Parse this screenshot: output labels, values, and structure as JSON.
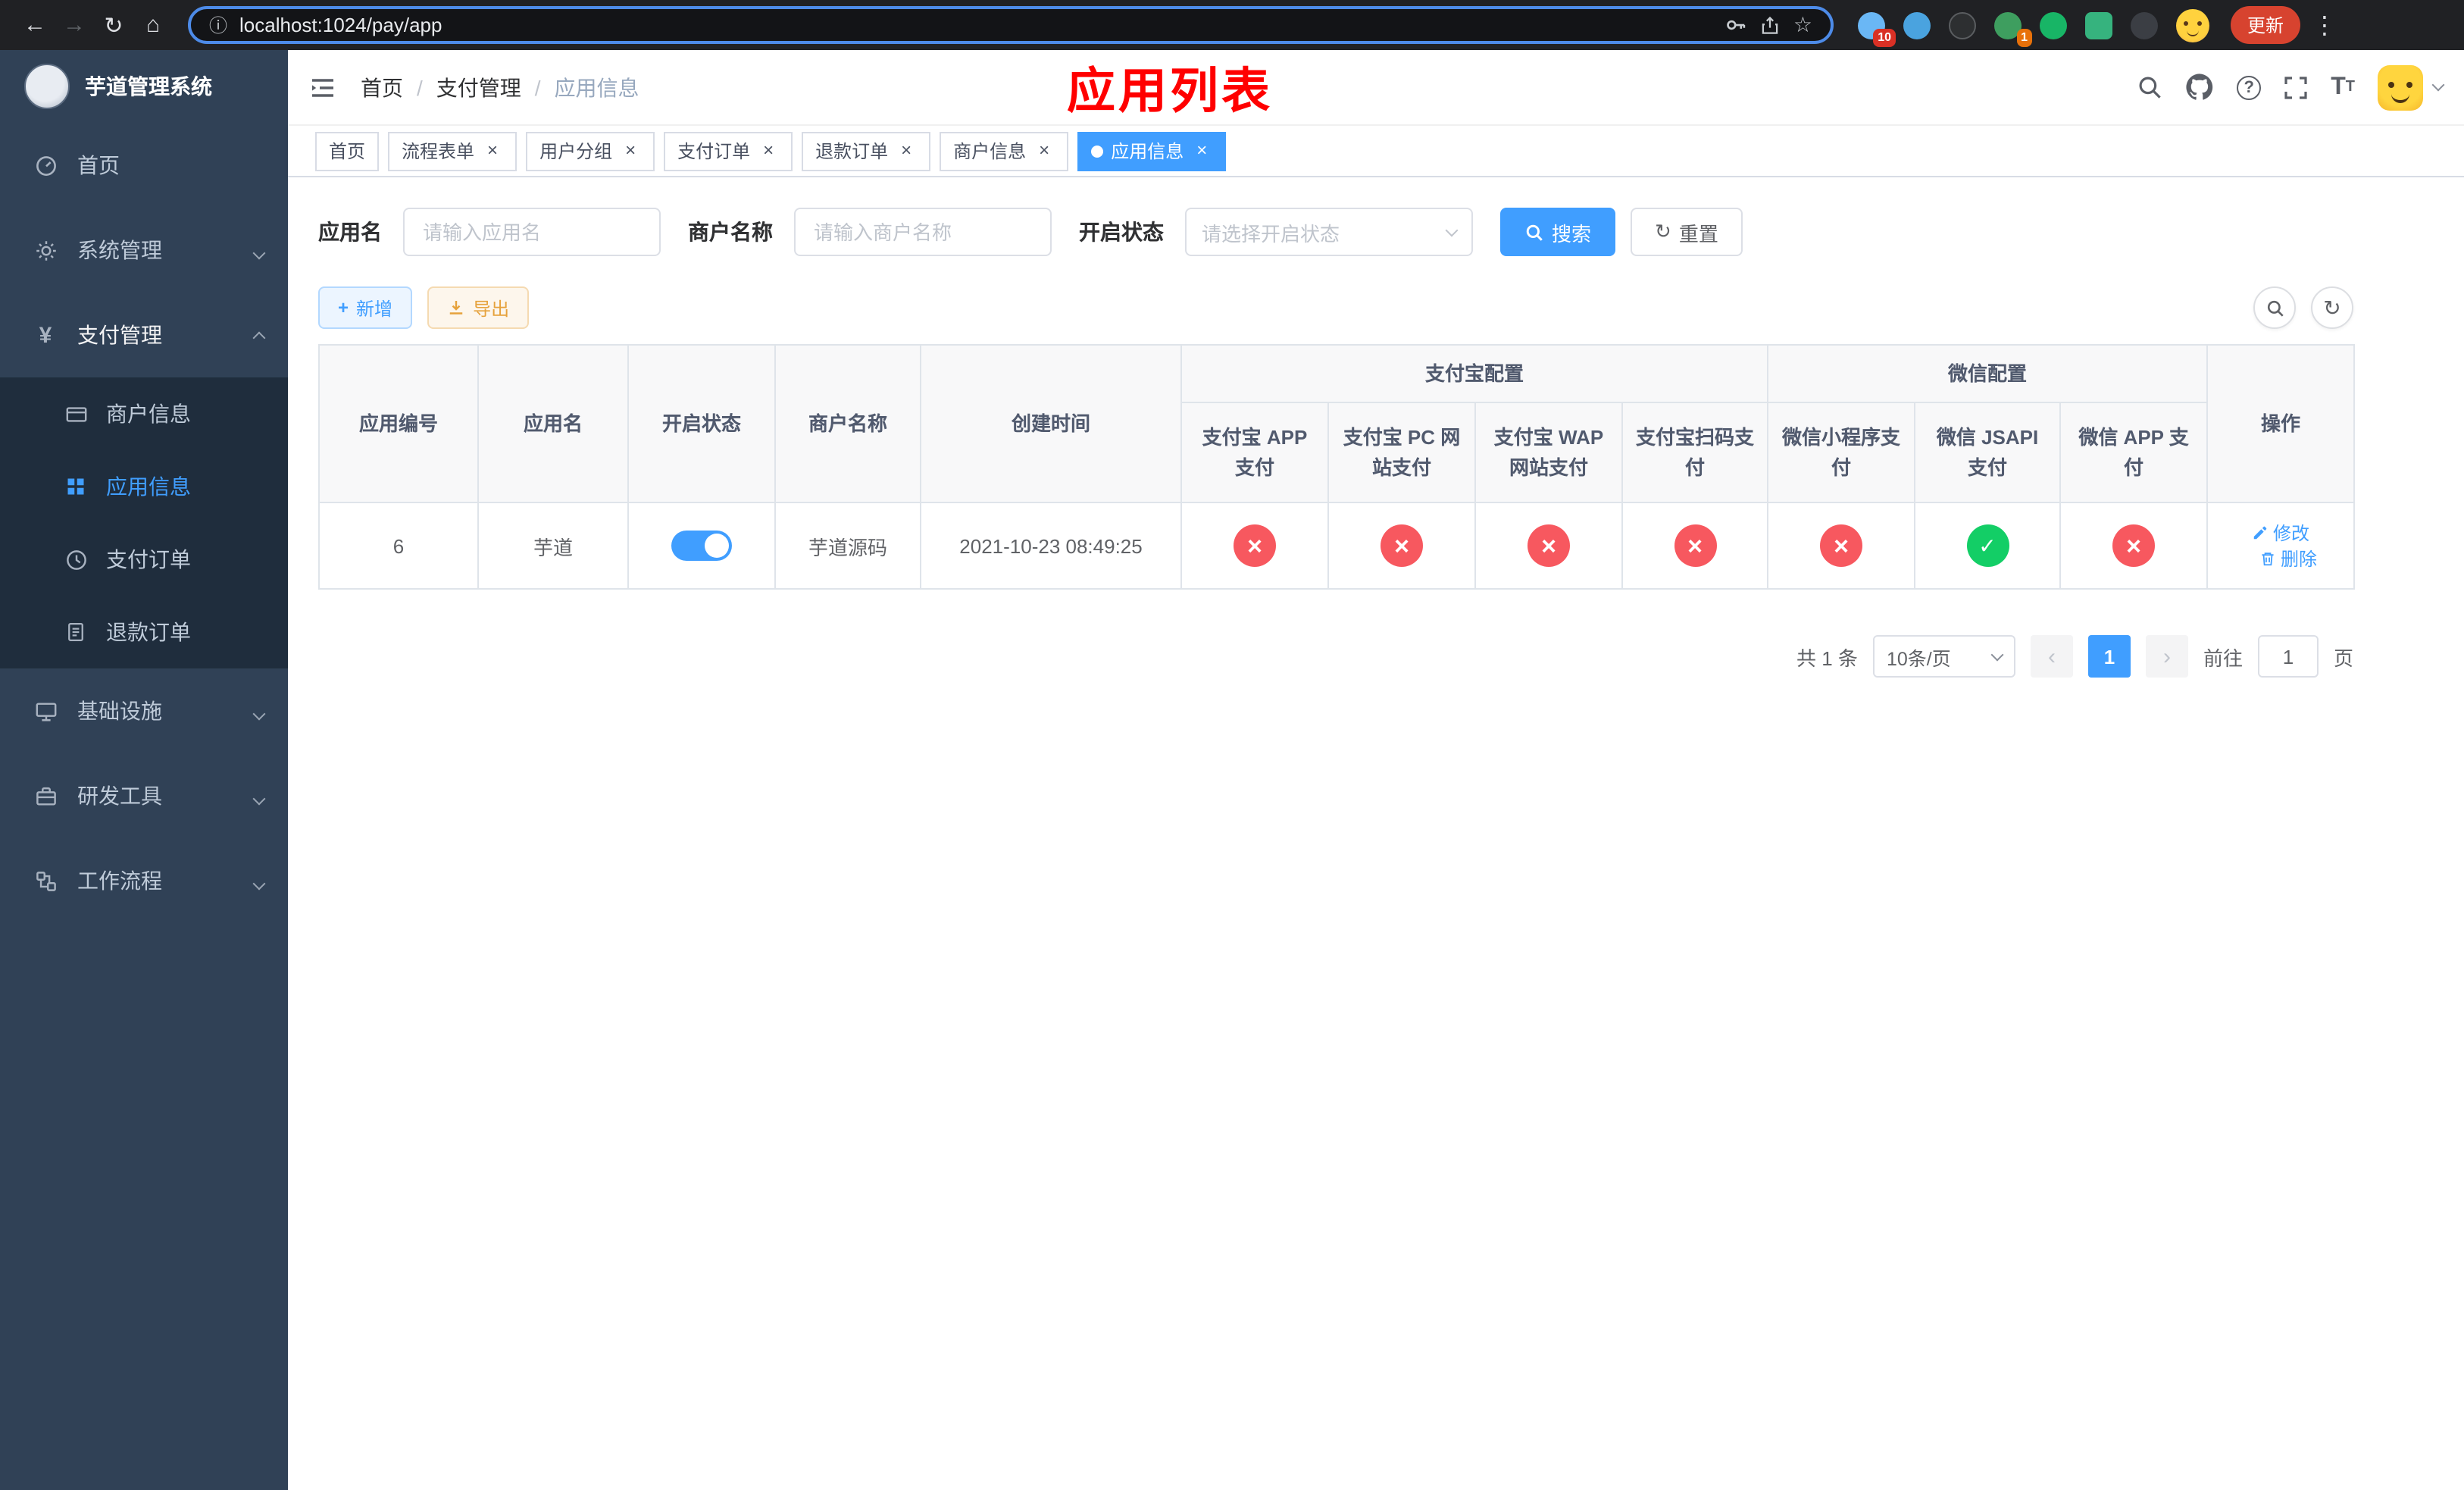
{
  "colors": {
    "accent": "#409eff",
    "danger": "#f7585f",
    "success": "#13ce66",
    "warning": "#e6a23c",
    "sidebar_bg": "#304156",
    "sidebar_submenu_bg": "#1f2d3d",
    "title_red": "#ff0000",
    "chrome_bg": "#202124"
  },
  "browser": {
    "url": "localhost:1024/pay/app",
    "update_button": "更新",
    "ext_badge_1": "10",
    "ext_badge_2": "1"
  },
  "sidebar": {
    "logo_title": "芋道管理系统",
    "items": [
      {
        "label": "首页"
      },
      {
        "label": "系统管理"
      },
      {
        "label": "支付管理"
      },
      {
        "label": "基础设施"
      },
      {
        "label": "研发工具"
      },
      {
        "label": "工作流程"
      }
    ],
    "payment_children": [
      {
        "label": "商户信息"
      },
      {
        "label": "应用信息"
      },
      {
        "label": "支付订单"
      },
      {
        "label": "退款订单"
      }
    ]
  },
  "header": {
    "breadcrumb": [
      "首页",
      "支付管理",
      "应用信息"
    ],
    "breadcrumb_separator": "/",
    "page_title": "应用列表"
  },
  "tabs": [
    {
      "label": "首页"
    },
    {
      "label": "流程表单"
    },
    {
      "label": "用户分组"
    },
    {
      "label": "支付订单"
    },
    {
      "label": "退款订单"
    },
    {
      "label": "商户信息"
    },
    {
      "label": "应用信息"
    }
  ],
  "filters": {
    "app_name_label": "应用名",
    "app_name_placeholder": "请输入应用名",
    "merchant_label": "商户名称",
    "merchant_placeholder": "请输入商户名称",
    "status_label": "开启状态",
    "status_placeholder": "请选择开启状态",
    "search_button": "搜索",
    "reset_button": "重置"
  },
  "toolbar": {
    "add_button": "新增",
    "export_button": "导出"
  },
  "table": {
    "col_id": "应用编号",
    "col_name": "应用名",
    "col_status": "开启状态",
    "col_merchant": "商户名称",
    "col_created": "创建时间",
    "group_alipay": "支付宝配置",
    "group_wechat": "微信配置",
    "col_alipay_app": "支付宝 APP 支付",
    "col_alipay_pc": "支付宝 PC 网站支付",
    "col_alipay_wap": "支付宝 WAP 网站支付",
    "col_alipay_scan": "支付宝扫码支付",
    "col_wechat_mini": "微信小程序支付",
    "col_wechat_jsapi": "微信 JSAPI 支付",
    "col_wechat_app": "微信 APP 支付",
    "col_actions": "操作",
    "row": {
      "id": "6",
      "name": "芋道",
      "switch_state": "on",
      "merchant": "芋道源码",
      "created": "2021-10-23 08:49:25",
      "alipay_app": "error",
      "alipay_pc": "error",
      "alipay_wap": "error",
      "alipay_scan": "error",
      "wechat_mini": "error",
      "wechat_jsapi": "success",
      "wechat_app": "error",
      "action_edit": "修改",
      "action_delete": "删除"
    }
  },
  "pagination": {
    "total": "共 1 条",
    "page_size": "10条/页",
    "page": "1",
    "goto_label": "前往",
    "goto_value": "1",
    "goto_suffix": "页"
  }
}
